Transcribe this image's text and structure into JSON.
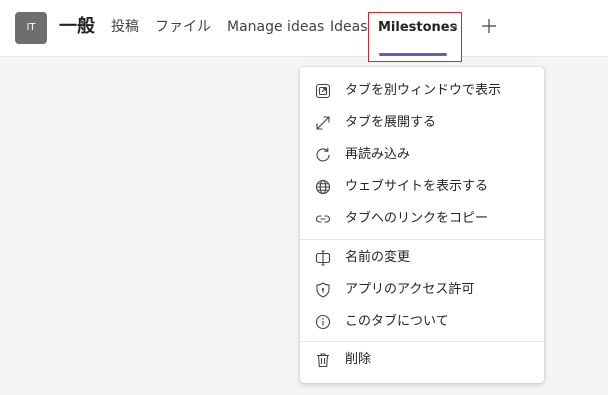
{
  "header": {
    "avatar_text": "IT",
    "channel_title": "一般",
    "tabs": [
      {
        "label": "投稿"
      },
      {
        "label": "ファイル"
      },
      {
        "label": "Manage ideas"
      },
      {
        "label": "Ideas"
      }
    ],
    "active_tab": {
      "label": "Milestones"
    }
  },
  "menu": {
    "items": [
      {
        "label": "タブを別ウィンドウで表示",
        "icon": "popout-icon"
      },
      {
        "label": "タブを展開する",
        "icon": "expand-icon"
      },
      {
        "label": "再読み込み",
        "icon": "refresh-icon"
      },
      {
        "label": "ウェブサイトを表示する",
        "icon": "globe-icon"
      },
      {
        "label": "タブへのリンクをコピー",
        "icon": "link-icon"
      },
      {
        "label": "名前の変更",
        "icon": "rename-icon"
      },
      {
        "label": "アプリのアクセス許可",
        "icon": "shield-icon"
      },
      {
        "label": "このタブについて",
        "icon": "info-icon"
      },
      {
        "label": "削除",
        "icon": "trash-icon"
      }
    ]
  },
  "colors": {
    "accent": "#5b5fc7",
    "highlight_border": "#d9262f",
    "avatar_bg": "#6e6e6e"
  }
}
